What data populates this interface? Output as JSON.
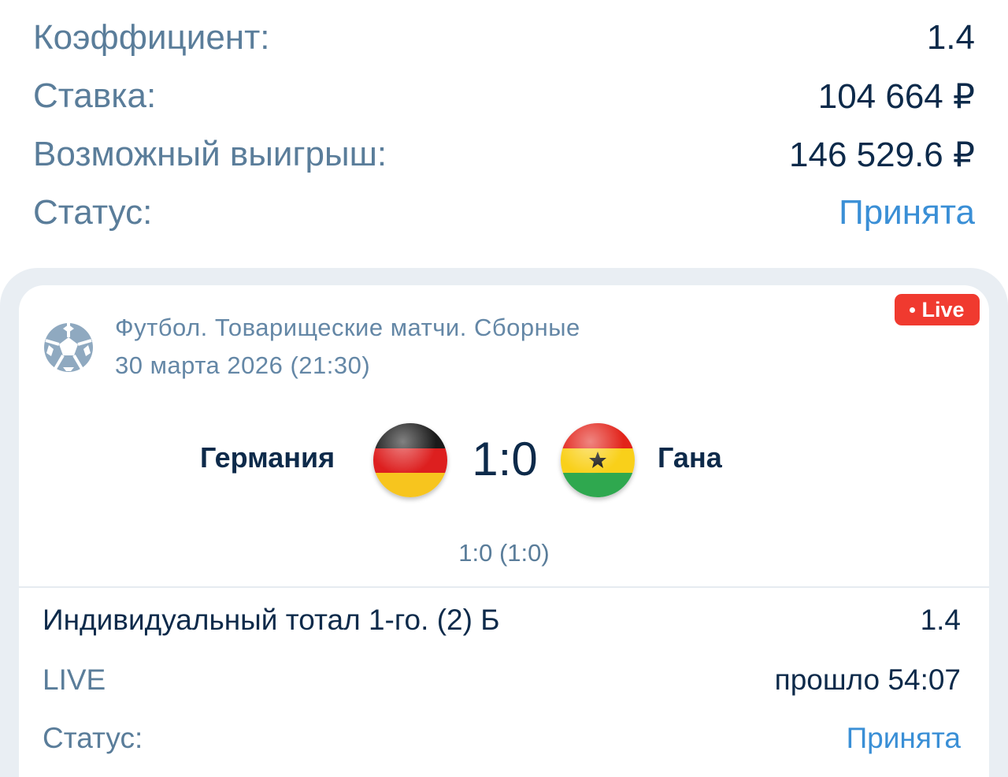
{
  "summary": {
    "coef_label": "Коэффициент:",
    "coef_value": "1.4",
    "stake_label": "Ставка:",
    "stake_value": "104 664 ₽",
    "win_label": "Возможный выигрыш:",
    "win_value": "146 529.6 ₽",
    "status_label": "Статус:",
    "status_value": "Принята"
  },
  "event": {
    "live_badge": "Live",
    "league": "Футбол. Товарищеские матчи. Сборные",
    "date": "30 марта 2026 (21:30)",
    "home_team": "Германия",
    "away_team": "Гана",
    "score": "1:0",
    "score_detail": "1:0 (1:0)",
    "sport_icon": "football-icon"
  },
  "bet": {
    "market": "Индивидуальный тотал 1-го. (2) Б",
    "odds": "1.4",
    "mode": "LIVE",
    "elapsed": "прошло 54:07",
    "status_label": "Статус:",
    "status_value": "Принята"
  },
  "colors": {
    "accent": "#3a8fd6",
    "text_dark": "#0d2a4a",
    "text_muted": "#5a7d9a",
    "live_red": "#f03a2f",
    "card_bg": "#e9eef3"
  }
}
